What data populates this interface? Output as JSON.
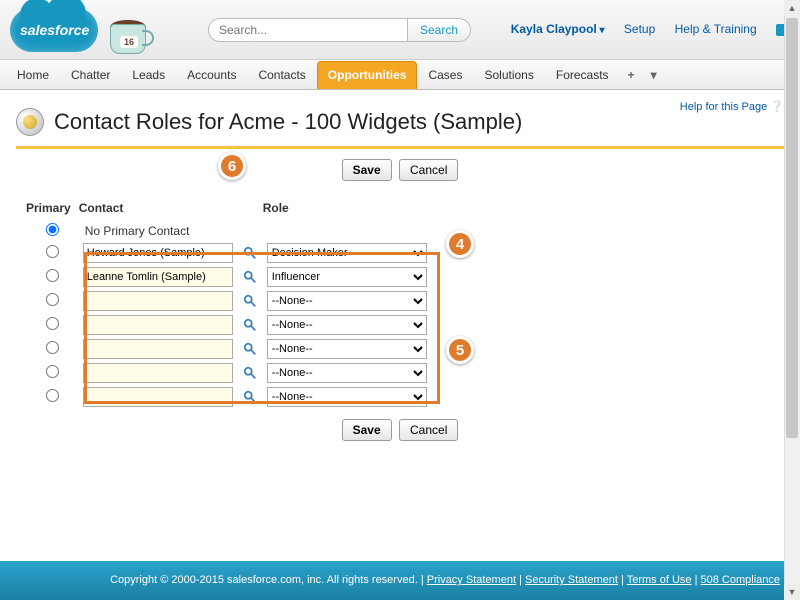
{
  "header": {
    "logo_text": "salesforce",
    "cup_badge": "16",
    "search_placeholder": "Search...",
    "search_button": "Search",
    "user_name": "Kayla Claypool",
    "links": {
      "setup": "Setup",
      "help": "Help & Training"
    }
  },
  "nav": {
    "tabs": [
      "Home",
      "Chatter",
      "Leads",
      "Accounts",
      "Contacts",
      "Opportunities",
      "Cases",
      "Solutions",
      "Forecasts"
    ],
    "active_index": 5,
    "plus": "+",
    "caret": "▾"
  },
  "page": {
    "help_link": "Help for this Page",
    "title": "Contact Roles for Acme - 100 Widgets (Sample)",
    "buttons": {
      "save": "Save",
      "cancel": "Cancel"
    },
    "columns": {
      "primary": "Primary",
      "contact": "Contact",
      "role": "Role"
    },
    "no_primary": "No Primary Contact",
    "role_options": [
      "--None--",
      "Decision Maker",
      "Influencer"
    ],
    "rows": [
      {
        "primary": true,
        "contact": "",
        "role": "",
        "is_header": true
      },
      {
        "primary": false,
        "contact": "Howard Jones (Sample)",
        "role": "Decision Maker",
        "plain": true
      },
      {
        "primary": false,
        "contact": "Leanne Tomlin (Sample)",
        "role": "Influencer"
      },
      {
        "primary": false,
        "contact": "",
        "role": "--None--"
      },
      {
        "primary": false,
        "contact": "",
        "role": "--None--"
      },
      {
        "primary": false,
        "contact": "",
        "role": "--None--"
      },
      {
        "primary": false,
        "contact": "",
        "role": "--None--"
      },
      {
        "primary": false,
        "contact": "",
        "role": "--None--"
      }
    ]
  },
  "callouts": {
    "c4": "4",
    "c5": "5",
    "c6": "6"
  },
  "footer": {
    "copyright": "Copyright © 2000-2015 salesforce.com, inc. All rights reserved.",
    "links": {
      "privacy": "Privacy Statement",
      "security": "Security Statement",
      "terms": "Terms of Use",
      "compliance": "508 Compliance"
    }
  }
}
